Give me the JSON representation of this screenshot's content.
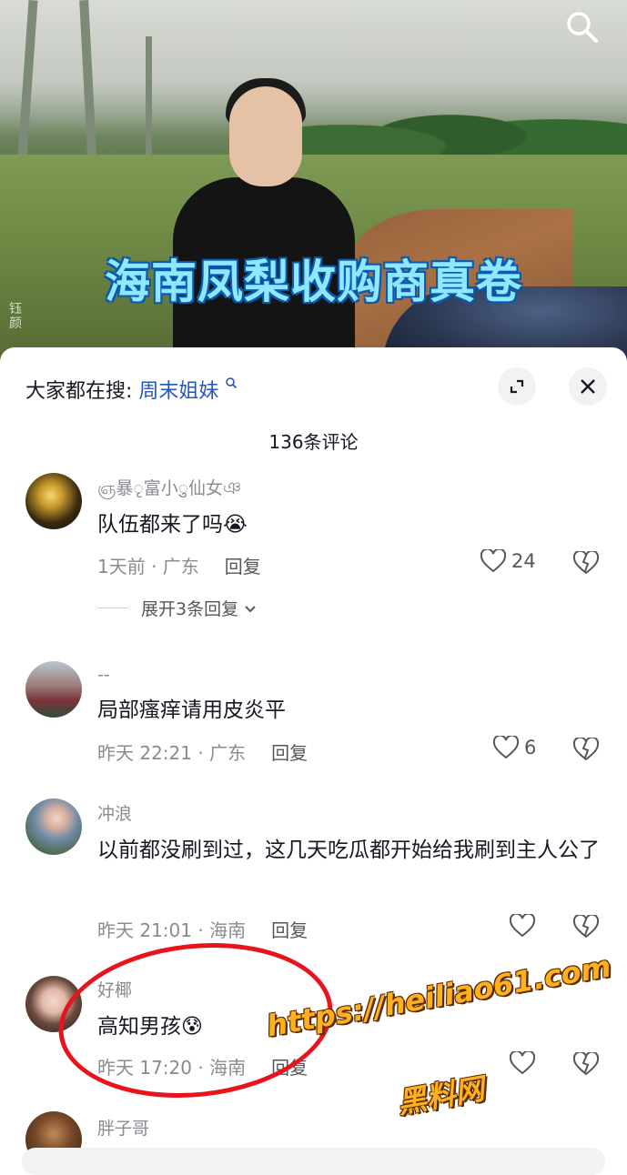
{
  "video": {
    "caption": "海南凤梨收购商真卷",
    "author_watermark": "钰颜"
  },
  "sheet": {
    "hot_search_prefix": "大家都在搜:",
    "hot_search_keyword": "周末姐妹",
    "comment_count": "136条评论"
  },
  "comments": [
    {
      "username": "ஞ暴ृ富小ु仙女ঞ",
      "text": "队伍都来了吗",
      "emoji": "😭",
      "time_location": "1天前 · 广东",
      "reply": "回复",
      "likes": "24",
      "expand": "展开3条回复"
    },
    {
      "username": "--",
      "text": "局部瘙痒请用皮炎平",
      "time_location": "昨天 22:21 · 广东",
      "reply": "回复",
      "likes": "6"
    },
    {
      "username": "冲浪",
      "text": "以前都没刷到过，这几天吃瓜都开始给我刷到主人公了",
      "time_location": "昨天 21:01 · 海南",
      "reply": "回复",
      "likes": ""
    },
    {
      "username": "好椰",
      "text": "高知男孩",
      "emoji": "😰",
      "time_location": "昨天 17:20 · 海南",
      "reply": "回复",
      "likes": ""
    },
    {
      "username": "胖子哥"
    }
  ],
  "watermark": {
    "url": "https://heiliao61.com",
    "site_name": "黑料网"
  },
  "colors": {
    "annotation_red": "#e8141b",
    "keyword_blue": "#2456c2",
    "watermark_orange": "#ffb01e"
  }
}
